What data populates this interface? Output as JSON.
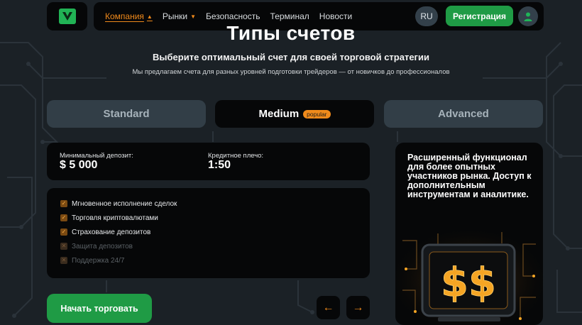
{
  "header": {
    "nav": [
      {
        "label": "Компания",
        "active": true,
        "dropdown": true
      },
      {
        "label": "Рынки",
        "active": false,
        "dropdown": true
      },
      {
        "label": "Безопасность",
        "active": false,
        "dropdown": false
      },
      {
        "label": "Терминал",
        "active": false,
        "dropdown": false
      },
      {
        "label": "Новости",
        "active": false,
        "dropdown": false
      }
    ],
    "lang": "RU",
    "register_label": "Регистрация"
  },
  "page": {
    "title": "Типы счетов",
    "subtitle": "Выберите оптимальный счет для своей торговой стратегии",
    "description": "Мы предлагаем счета для разных уровней подготовки трейдеров — от новичков до профессионалов"
  },
  "tabs": [
    {
      "label": "Standard",
      "active": false
    },
    {
      "label": "Medium",
      "active": true,
      "badge": "popular"
    },
    {
      "label": "Advanced",
      "active": false
    }
  ],
  "account": {
    "min_deposit_label": "Минимальный депозит:",
    "min_deposit_value": "$ 5 000",
    "leverage_label": "Кредитное плечо:",
    "leverage_value": "1:50",
    "features": [
      {
        "label": "Мгновенное исполнение сделок",
        "enabled": true
      },
      {
        "label": "Торговля криптовалютами",
        "enabled": true
      },
      {
        "label": "Страхование депозитов",
        "enabled": true
      },
      {
        "label": "Защита депозитов",
        "enabled": false
      },
      {
        "label": "Поддержка 24/7",
        "enabled": false
      }
    ],
    "start_label": "Начать торговать",
    "description": "Расширенный функционал для более опытных участников рынка. Доступ к дополнительным инструментам и аналитике.",
    "illustration_glyph": "$$"
  },
  "icons": {
    "check": "✓",
    "cross": "✕",
    "prev_arrow": "←",
    "next_arrow": "→",
    "caret": "▲"
  },
  "colors": {
    "accent_orange": "#f08a1b",
    "brand_green": "#1f9b45",
    "card_black": "#060708",
    "tab_inactive": "#323e47",
    "background": "#1b2126"
  }
}
